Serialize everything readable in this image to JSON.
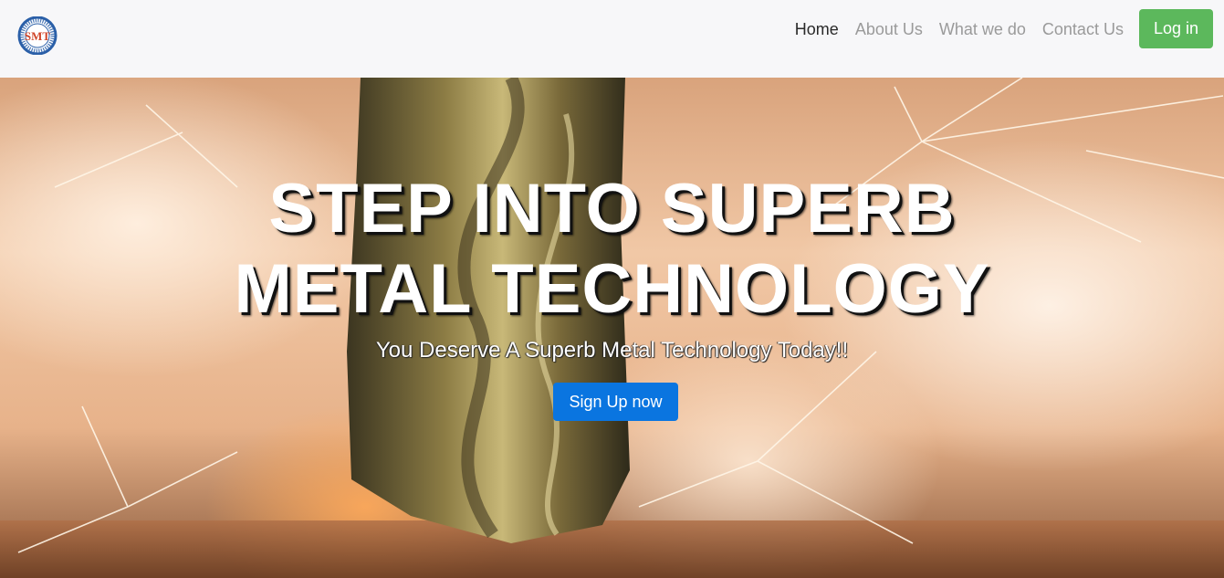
{
  "brand": {
    "logo_text": "SMT",
    "logo_ring_text": "SUPERB METAL TECHNOLOGY"
  },
  "nav": {
    "items": [
      {
        "label": "Home",
        "active": true
      },
      {
        "label": "About Us",
        "active": false
      },
      {
        "label": "What we do",
        "active": false
      },
      {
        "label": "Contact Us",
        "active": false
      }
    ],
    "login_label": "Log in"
  },
  "hero": {
    "title_line1": "STEP INTO SUPERB",
    "title_line2": "METAL TECHNOLOGY",
    "subtitle": "You Deserve A Superb Metal Technology Today!!",
    "cta_label": "Sign Up now"
  },
  "colors": {
    "navbar_bg": "#f7f7f9",
    "login_green": "#5cb85c",
    "cta_blue": "#0a75e0",
    "logo_blue": "#2a5fa8",
    "logo_red": "#d0462a"
  }
}
